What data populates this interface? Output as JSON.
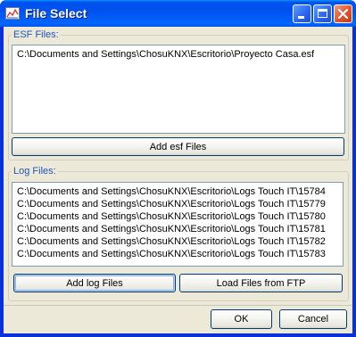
{
  "window": {
    "title": "File Select",
    "icon": "chart-icon"
  },
  "esf": {
    "legend": "ESF Files:",
    "files": [
      "C:\\Documents and Settings\\ChosuKNX\\Escritorio\\Proyecto Casa.esf"
    ],
    "add_label": "Add esf Files"
  },
  "log": {
    "legend": "Log Files:",
    "files": [
      "C:\\Documents and Settings\\ChosuKNX\\Escritorio\\Logs Touch IT\\15784",
      "C:\\Documents and Settings\\ChosuKNX\\Escritorio\\Logs Touch IT\\15779",
      "C:\\Documents and Settings\\ChosuKNX\\Escritorio\\Logs Touch IT\\15780",
      "C:\\Documents and Settings\\ChosuKNX\\Escritorio\\Logs Touch IT\\15781",
      "C:\\Documents and Settings\\ChosuKNX\\Escritorio\\Logs Touch IT\\15782",
      "C:\\Documents and Settings\\ChosuKNX\\Escritorio\\Logs Touch IT\\15783"
    ],
    "add_label": "Add log Files",
    "ftp_label": "Load Files from FTP"
  },
  "footer": {
    "ok_label": "OK",
    "cancel_label": "Cancel"
  },
  "colors": {
    "titlebar": "#0054e3",
    "legend_text": "#2154b8",
    "dialog_bg": "#ece9d8"
  }
}
